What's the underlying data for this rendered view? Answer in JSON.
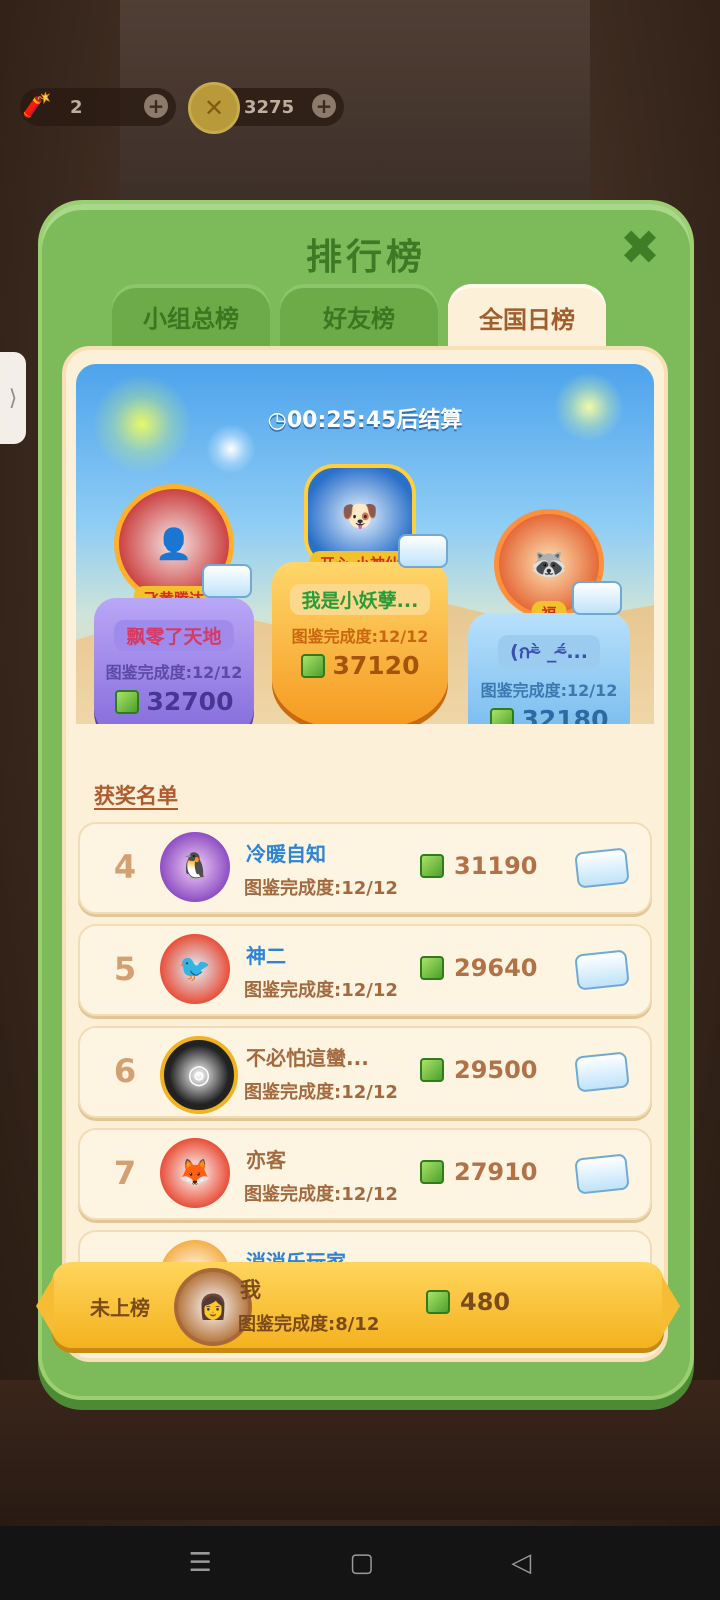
{
  "topbar": {
    "item_count": "2",
    "coin_count": "3275",
    "plus_label": "+"
  },
  "dialog": {
    "title": "排行榜",
    "close_label": "✖",
    "tabs": [
      {
        "label": "小组总榜",
        "active": false
      },
      {
        "label": "好友榜",
        "active": false
      },
      {
        "label": "全国日榜",
        "active": true
      }
    ],
    "timer": "00:25:45后结算"
  },
  "podium": [
    {
      "position": "second",
      "frame_label": "飞黄腾达",
      "name": "飘零了天地",
      "progress": "图鉴完成度:12/12",
      "score": "32700"
    },
    {
      "position": "first",
      "frame_label": "开心 小神仙",
      "name": "我是小妖孽...",
      "progress": "图鉴完成度:12/12",
      "score": "37120"
    },
    {
      "position": "third",
      "frame_label": "福",
      "name": "(ก⁼̴̀ _⁼̴́...",
      "progress": "图鉴完成度:12/12",
      "score": "32180"
    }
  ],
  "section_title": "获奖名单",
  "list": [
    {
      "rank": "4",
      "name": "冷暖自知",
      "progress": "图鉴完成度:12/12",
      "score": "31190",
      "name_color": "#2b84d8"
    },
    {
      "rank": "5",
      "name": "神二",
      "progress": "图鉴完成度:12/12",
      "score": "29640",
      "name_color": "#2b84d8"
    },
    {
      "rank": "6",
      "name": "不必怕這蠻...",
      "progress": "图鉴完成度:12/12",
      "score": "29500",
      "name_color": "#a46a3f"
    },
    {
      "rank": "7",
      "name": "亦客",
      "progress": "图鉴完成度:12/12",
      "score": "27910",
      "name_color": "#a46a3f"
    },
    {
      "rank": "",
      "name": "消消乐玩家",
      "progress": "",
      "score": "",
      "name_color": "#2b84d8"
    }
  ],
  "me": {
    "status": "未上榜",
    "name": "我",
    "progress": "图鉴完成度:8/12",
    "score": "480"
  },
  "navbar": {
    "menu_icon": "☰",
    "home_icon": "▢",
    "back_icon": "◁"
  },
  "side_handle": "⟩",
  "colors": {
    "dialog_green": "#7dbb5a",
    "panel_cream": "#fdf0d8",
    "accent_orange": "#f4b21f"
  }
}
